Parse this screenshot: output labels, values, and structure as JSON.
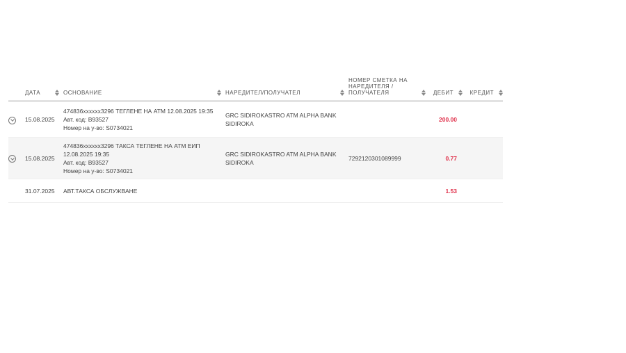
{
  "headers": {
    "date": "ДАТА",
    "basis": "ОСНОВАНИЕ",
    "party": "НАРЕДИТЕЛ/ПОЛУЧАТЕЛ",
    "account_line1": "НОМЕР СМЕТКА НА",
    "account_line2": "НАРЕДИТЕЛЯ /",
    "account_line3": "ПОЛУЧАТЕЛЯ",
    "debit": "ДЕБИТ",
    "credit": "КРЕДИТ"
  },
  "rows": [
    {
      "date": "15.08.2025",
      "basis": [
        "474836xxxxxx3296 ТЕГЛЕНЕ НА АТМ 12.08.2025 19:35",
        "Авт. код: B93527",
        "Номер на у-во: S0734021"
      ],
      "party": [
        "GRC SIDIROKASTRO ATM ALPHA BANK",
        "SIDIROKA"
      ],
      "account": "",
      "debit": "200.00",
      "credit": ""
    },
    {
      "date": "15.08.2025",
      "basis": [
        "474836xxxxxx3296 ТАКСА ТЕГЛЕНЕ НА АТМ ЕИП",
        "12.08.2025 19:35",
        "Авт. код: B93527",
        "Номер на у-во: S0734021"
      ],
      "party": [
        "GRC SIDIROKASTRO ATM ALPHA BANK",
        "SIDIROKA"
      ],
      "account": "7292120301089999",
      "debit": "0.77",
      "credit": ""
    },
    {
      "date": "31.07.2025",
      "basis": [
        "АВТ.ТАКСА ОБСЛУЖВАНЕ"
      ],
      "party": [],
      "account": "",
      "debit": "1.53",
      "credit": ""
    }
  ],
  "colors": {
    "debit": "#e0314b",
    "row_alt": "#f5f5f5"
  }
}
